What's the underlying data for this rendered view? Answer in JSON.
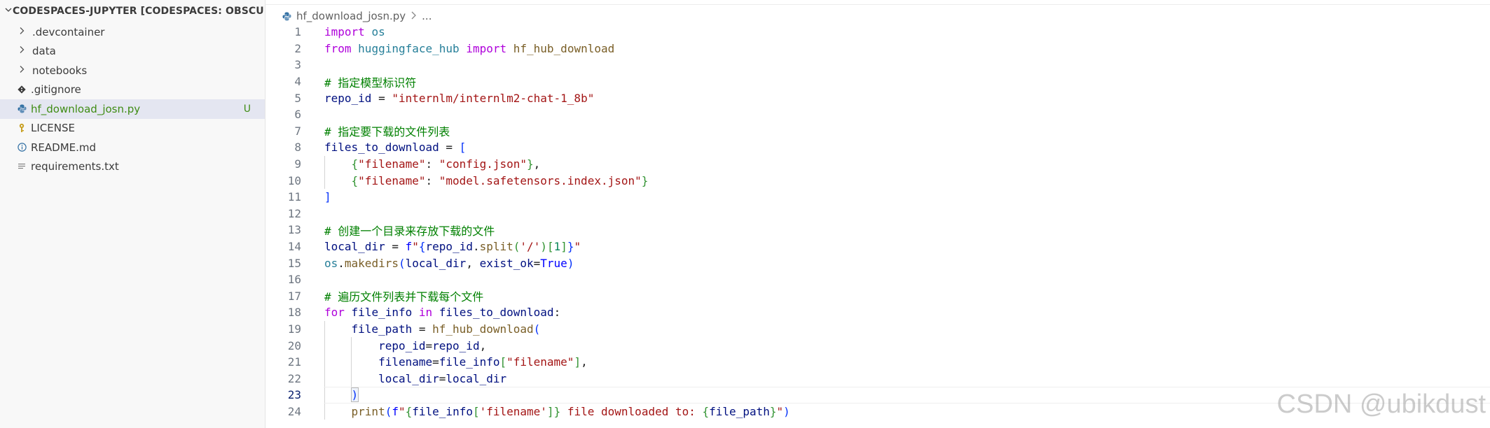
{
  "explorer": {
    "title": "CODESPACES-JUPYTER [CODESPACES: OBSCURE SP...",
    "items": [
      {
        "label": ".devcontainer",
        "type": "folder",
        "icon": "chevron-right-icon"
      },
      {
        "label": "data",
        "type": "folder",
        "icon": "chevron-right-icon"
      },
      {
        "label": "notebooks",
        "type": "folder",
        "icon": "chevron-right-icon"
      },
      {
        "label": ".gitignore",
        "type": "file",
        "icon": "git-icon"
      },
      {
        "label": "hf_download_josn.py",
        "type": "file",
        "icon": "python-icon",
        "selected": true,
        "badge": "U"
      },
      {
        "label": "LICENSE",
        "type": "file",
        "icon": "license-key-icon"
      },
      {
        "label": "README.md",
        "type": "file",
        "icon": "info-icon"
      },
      {
        "label": "requirements.txt",
        "type": "file",
        "icon": "text-lines-icon"
      }
    ]
  },
  "breadcrumb": {
    "file": "hf_download_josn.py",
    "more": "..."
  },
  "editor": {
    "active_line": 23,
    "lines": [
      {
        "n": "1",
        "tokens": [
          [
            "kw",
            "import"
          ],
          [
            "op",
            " "
          ],
          [
            "mod",
            "os"
          ]
        ]
      },
      {
        "n": "2",
        "tokens": [
          [
            "kw",
            "from"
          ],
          [
            "op",
            " "
          ],
          [
            "mod",
            "huggingface_hub"
          ],
          [
            "op",
            " "
          ],
          [
            "kw",
            "import"
          ],
          [
            "op",
            " "
          ],
          [
            "fn",
            "hf_hub_download"
          ]
        ]
      },
      {
        "n": "3",
        "tokens": []
      },
      {
        "n": "4",
        "tokens": [
          [
            "cm",
            "# 指定模型标识符"
          ]
        ]
      },
      {
        "n": "5",
        "tokens": [
          [
            "var",
            "repo_id"
          ],
          [
            "op",
            " = "
          ],
          [
            "str",
            "\"internlm/internlm2-chat-1_8b\""
          ]
        ]
      },
      {
        "n": "6",
        "tokens": []
      },
      {
        "n": "7",
        "tokens": [
          [
            "cm",
            "# 指定要下载的文件列表"
          ]
        ]
      },
      {
        "n": "8",
        "tokens": [
          [
            "var",
            "files_to_download"
          ],
          [
            "op",
            " = "
          ],
          [
            "br1",
            "["
          ]
        ]
      },
      {
        "n": "9",
        "tokens": [
          [
            "op",
            "    "
          ],
          [
            "br2",
            "{"
          ],
          [
            "str",
            "\"filename\""
          ],
          [
            "op",
            ": "
          ],
          [
            "str",
            "\"config.json\""
          ],
          [
            "br2",
            "}"
          ],
          [
            "op",
            ","
          ]
        ]
      },
      {
        "n": "10",
        "tokens": [
          [
            "op",
            "    "
          ],
          [
            "br2",
            "{"
          ],
          [
            "str",
            "\"filename\""
          ],
          [
            "op",
            ": "
          ],
          [
            "str",
            "\"model.safetensors.index.json\""
          ],
          [
            "br2",
            "}"
          ]
        ]
      },
      {
        "n": "11",
        "tokens": [
          [
            "br1",
            "]"
          ]
        ]
      },
      {
        "n": "12",
        "tokens": []
      },
      {
        "n": "13",
        "tokens": [
          [
            "cm",
            "# 创建一个目录来存放下载的文件"
          ]
        ]
      },
      {
        "n": "14",
        "tokens": [
          [
            "var",
            "local_dir"
          ],
          [
            "op",
            " = "
          ],
          [
            "bool",
            "f"
          ],
          [
            "str",
            "\""
          ],
          [
            "br1",
            "{"
          ],
          [
            "var",
            "repo_id"
          ],
          [
            "op",
            "."
          ],
          [
            "fn",
            "split"
          ],
          [
            "br2",
            "("
          ],
          [
            "str",
            "'/'"
          ],
          [
            "br2",
            ")"
          ],
          [
            "br2",
            "["
          ],
          [
            "num",
            "1"
          ],
          [
            "br2",
            "]"
          ],
          [
            "br1",
            "}"
          ],
          [
            "str",
            "\""
          ]
        ]
      },
      {
        "n": "15",
        "tokens": [
          [
            "mod",
            "os"
          ],
          [
            "op",
            "."
          ],
          [
            "fn",
            "makedirs"
          ],
          [
            "br1",
            "("
          ],
          [
            "var",
            "local_dir"
          ],
          [
            "op",
            ", "
          ],
          [
            "var",
            "exist_ok"
          ],
          [
            "op",
            "="
          ],
          [
            "bool",
            "True"
          ],
          [
            "br1",
            ")"
          ]
        ]
      },
      {
        "n": "16",
        "tokens": []
      },
      {
        "n": "17",
        "tokens": [
          [
            "cm",
            "# 遍历文件列表并下载每个文件"
          ]
        ]
      },
      {
        "n": "18",
        "tokens": [
          [
            "kw",
            "for"
          ],
          [
            "op",
            " "
          ],
          [
            "var",
            "file_info"
          ],
          [
            "op",
            " "
          ],
          [
            "kw",
            "in"
          ],
          [
            "op",
            " "
          ],
          [
            "var",
            "files_to_download"
          ],
          [
            "op",
            ":"
          ]
        ]
      },
      {
        "n": "19",
        "tokens": [
          [
            "op",
            "    "
          ],
          [
            "var",
            "file_path"
          ],
          [
            "op",
            " = "
          ],
          [
            "fn",
            "hf_hub_download"
          ],
          [
            "br1",
            "("
          ]
        ]
      },
      {
        "n": "20",
        "tokens": [
          [
            "op",
            "        "
          ],
          [
            "var",
            "repo_id"
          ],
          [
            "op",
            "="
          ],
          [
            "var",
            "repo_id"
          ],
          [
            "op",
            ","
          ]
        ]
      },
      {
        "n": "21",
        "tokens": [
          [
            "op",
            "        "
          ],
          [
            "var",
            "filename"
          ],
          [
            "op",
            "="
          ],
          [
            "var",
            "file_info"
          ],
          [
            "br2",
            "["
          ],
          [
            "str",
            "\"filename\""
          ],
          [
            "br2",
            "]"
          ],
          [
            "op",
            ","
          ]
        ]
      },
      {
        "n": "22",
        "tokens": [
          [
            "op",
            "        "
          ],
          [
            "var",
            "local_dir"
          ],
          [
            "op",
            "="
          ],
          [
            "var",
            "local_dir"
          ]
        ]
      },
      {
        "n": "23",
        "tokens": [
          [
            "op",
            "    "
          ],
          [
            "br1",
            ")"
          ]
        ]
      },
      {
        "n": "24",
        "tokens": [
          [
            "op",
            "    "
          ],
          [
            "fn",
            "print"
          ],
          [
            "br1",
            "("
          ],
          [
            "bool",
            "f"
          ],
          [
            "str",
            "\""
          ],
          [
            "br2",
            "{"
          ],
          [
            "var",
            "file_info"
          ],
          [
            "br2",
            "["
          ],
          [
            "str",
            "'filename'"
          ],
          [
            "br2",
            "]"
          ],
          [
            "br2",
            "}"
          ],
          [
            "str",
            " file downloaded to: "
          ],
          [
            "br2",
            "{"
          ],
          [
            "var",
            "file_path"
          ],
          [
            "br2",
            "}"
          ],
          [
            "str",
            "\""
          ],
          [
            "br1",
            ")"
          ]
        ]
      }
    ]
  },
  "watermark": "CSDN @ubikdust",
  "colors": {
    "keyword": "#af00db",
    "module": "#267f99",
    "function": "#795e26",
    "comment": "#008000",
    "string": "#a31515",
    "variable": "#001080",
    "untracked": "#3f8c14",
    "selection": "#e4e6f1"
  }
}
